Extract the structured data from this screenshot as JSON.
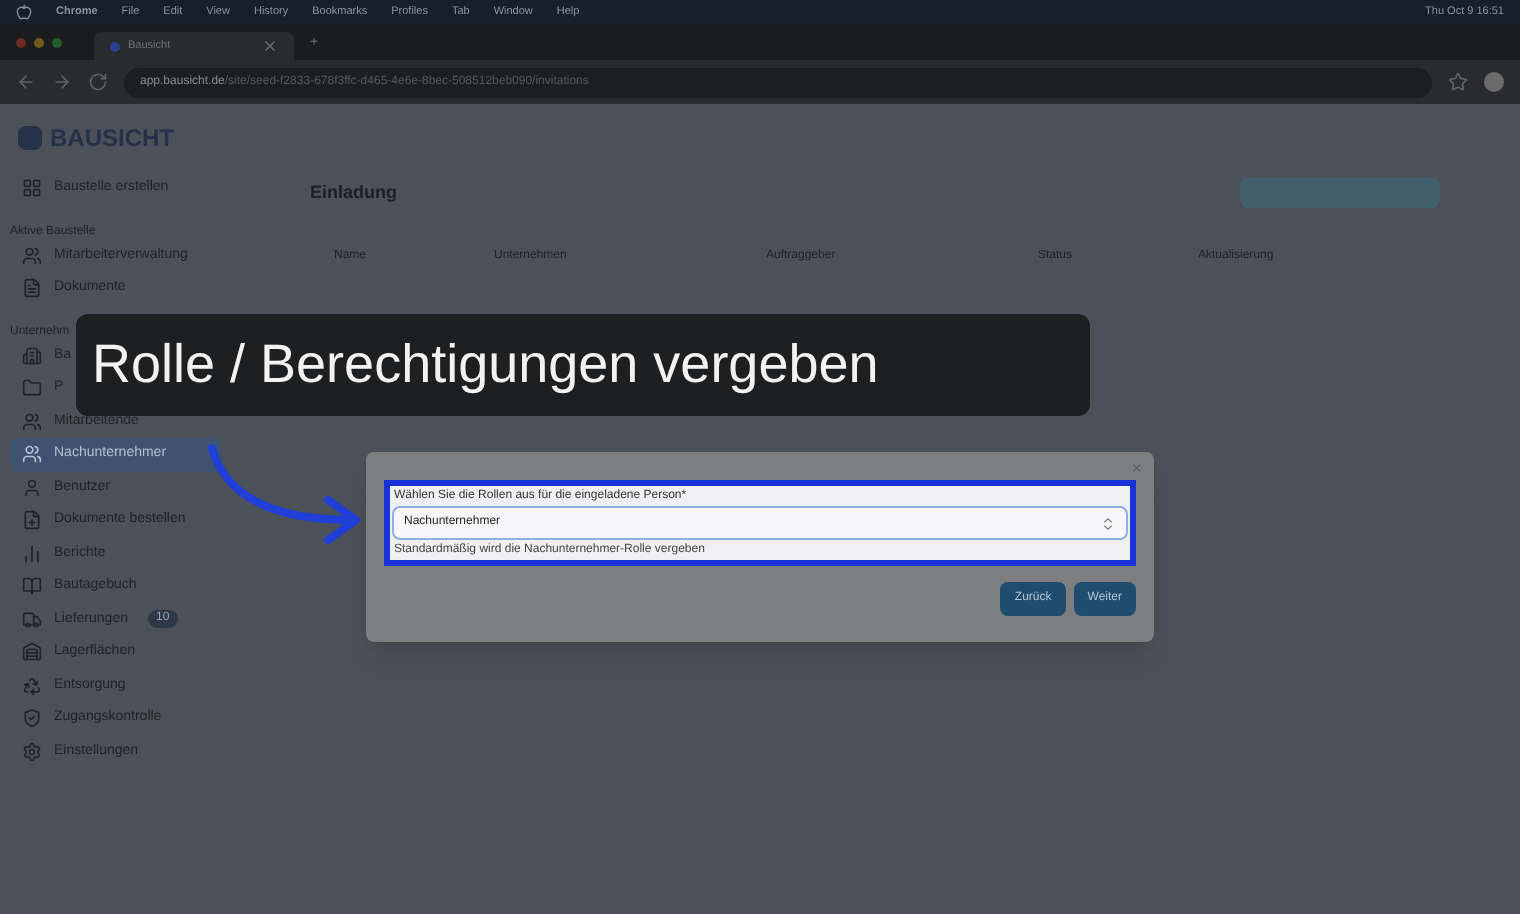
{
  "menubar": {
    "items": [
      "Chrome",
      "File",
      "Edit",
      "View",
      "History",
      "Bookmarks",
      "Profiles",
      "Tab",
      "Window",
      "Help"
    ],
    "clock": "Thu Oct 9  16:51"
  },
  "browser": {
    "tab": {
      "title": "Bausicht",
      "selected": true
    },
    "new_tab": "+",
    "url_host": "app.bausicht.de",
    "url_path": "/site/seed-f2833-678f3ffc-d465-4e6e-8bec-508512beb090/invitations"
  },
  "sidebar": {
    "logo": "BAUSICHT",
    "items": [
      {
        "kind": "item",
        "label": "Baustelle erstellen",
        "selected": false
      },
      {
        "kind": "section",
        "label": "Aktive Baustelle"
      },
      {
        "kind": "item",
        "label": "Mitarbeiterverwaltung",
        "selected": false
      },
      {
        "kind": "item",
        "label": "Dokumente",
        "selected": false
      },
      {
        "kind": "section",
        "label": "Unternehm"
      },
      {
        "kind": "item",
        "label": "Ba",
        "selected": false
      },
      {
        "kind": "item",
        "label": "P",
        "selected": false
      },
      {
        "kind": "item",
        "label": "Mitarbeitende",
        "selected": false
      },
      {
        "kind": "item",
        "label": "Nachunternehmer",
        "selected": true
      },
      {
        "kind": "item",
        "label": "Benutzer",
        "selected": false
      },
      {
        "kind": "item",
        "label": "Dokumente bestellen",
        "selected": false
      },
      {
        "kind": "item",
        "label": "Berichte",
        "selected": false
      },
      {
        "kind": "item",
        "label": "Bautagebuch",
        "selected": false
      },
      {
        "kind": "item",
        "label": "Lieferungen",
        "selected": false,
        "badge": "10"
      },
      {
        "kind": "item",
        "label": "Lagerflächen",
        "selected": false
      },
      {
        "kind": "item",
        "label": "Entsorgung",
        "selected": false
      },
      {
        "kind": "item",
        "label": "Zugangskontrolle",
        "selected": false
      },
      {
        "kind": "item",
        "label": "Einstellungen",
        "selected": false
      }
    ]
  },
  "main": {
    "title": "Einladung",
    "columns": [
      "Name",
      "Unternehmen",
      "Auftraggeber",
      "Status",
      "Aktualisierung"
    ]
  },
  "callout": {
    "text": "Rolle / Berechtigungen vergeben"
  },
  "dialog": {
    "close": "×",
    "label": "Wählen Sie die Rollen aus für die eingeladene Person*",
    "select_value": "Nachunternehmer",
    "help": "Standardmäßig wird die Nachunternehmer-Rolle vergeben",
    "buttons": [
      "Zurück",
      "Weiter"
    ]
  }
}
